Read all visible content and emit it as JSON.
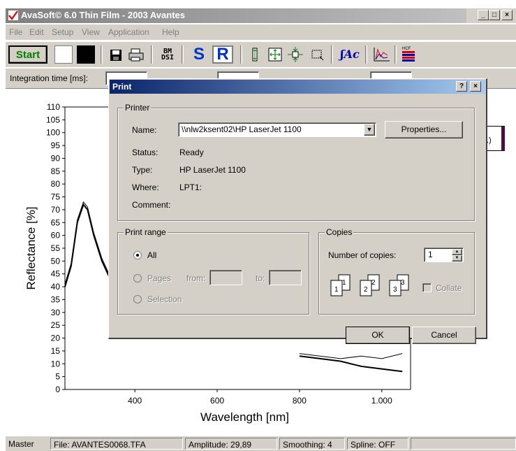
{
  "window": {
    "title": "AvaSoft© 6.0 Thin Film - 2003 Avantes"
  },
  "menu": [
    "File",
    "Edit",
    "Setup",
    "View",
    "Application",
    "Help"
  ],
  "toolbar": {
    "start_label": "Start",
    "s_label": "S",
    "r_label": "R",
    "bm_label": "BM\nDSI",
    "fac_label": "ʃAc",
    "hcf_label": "HCF"
  },
  "options": {
    "integration_label": "Integration time [ms]:"
  },
  "chart_data": {
    "type": "line",
    "xlabel": "Wavelength [nm]",
    "ylabel": "Reflectance [%]",
    "xlim": [
      230,
      1070
    ],
    "ylim": [
      0,
      110
    ],
    "xticks": [
      "400",
      "600",
      "800",
      "1.000"
    ],
    "yticks": [
      "0",
      "5",
      "10",
      "15",
      "20",
      "25",
      "30",
      "35",
      "40",
      "45",
      "50",
      "55",
      "60",
      "65",
      "70",
      "75",
      "80",
      "85",
      "90",
      "95",
      "100",
      "105",
      "110"
    ],
    "series": [
      {
        "x": [
          230,
          245,
          260,
          275,
          285,
          300,
          320,
          340,
          345
        ],
        "y": [
          40,
          48,
          65,
          72,
          70,
          60,
          50,
          43,
          42
        ]
      },
      {
        "x": [
          230,
          245,
          260,
          275,
          285,
          300,
          320,
          340,
          345
        ],
        "y": [
          41,
          49,
          66,
          73,
          71,
          61,
          51,
          44,
          43
        ]
      },
      {
        "x": [
          800,
          850,
          900,
          950,
          1000,
          1050
        ],
        "y": [
          13,
          12,
          11,
          9,
          8,
          7
        ]
      },
      {
        "x": [
          800,
          850,
          900,
          950,
          1000,
          1050
        ],
        "y": [
          14,
          13,
          12,
          13,
          12,
          14
        ]
      }
    ],
    "legend_stub": ".)"
  },
  "status": {
    "mode": "Master",
    "file": "File: AVANTES0068.TFA",
    "amplitude": "Amplitude: 29,89",
    "smoothing": "Smoothing: 4",
    "spline": "Spline: OFF"
  },
  "dialog": {
    "title": "Print",
    "help": "?",
    "close": "×",
    "printer_group": "Printer",
    "name_label": "Name:",
    "name_value": "\\\\nlw2ksent02\\HP LaserJet 1100",
    "properties_label": "Properties...",
    "status_label": "Status:",
    "status_value": "Ready",
    "type_label": "Type:",
    "type_value": "HP LaserJet 1100",
    "where_label": "Where:",
    "where_value": "LPT1:",
    "comment_label": "Comment:",
    "range_group": "Print range",
    "all_label": "All",
    "pages_label": "Pages",
    "from_label": "from:",
    "to_label": "to:",
    "selection_label": "Selection",
    "copies_group": "Copies",
    "num_copies_label": "Number of copies:",
    "num_copies_value": "1",
    "collate_label": "Collate",
    "ok_label": "OK",
    "cancel_label": "Cancel"
  }
}
